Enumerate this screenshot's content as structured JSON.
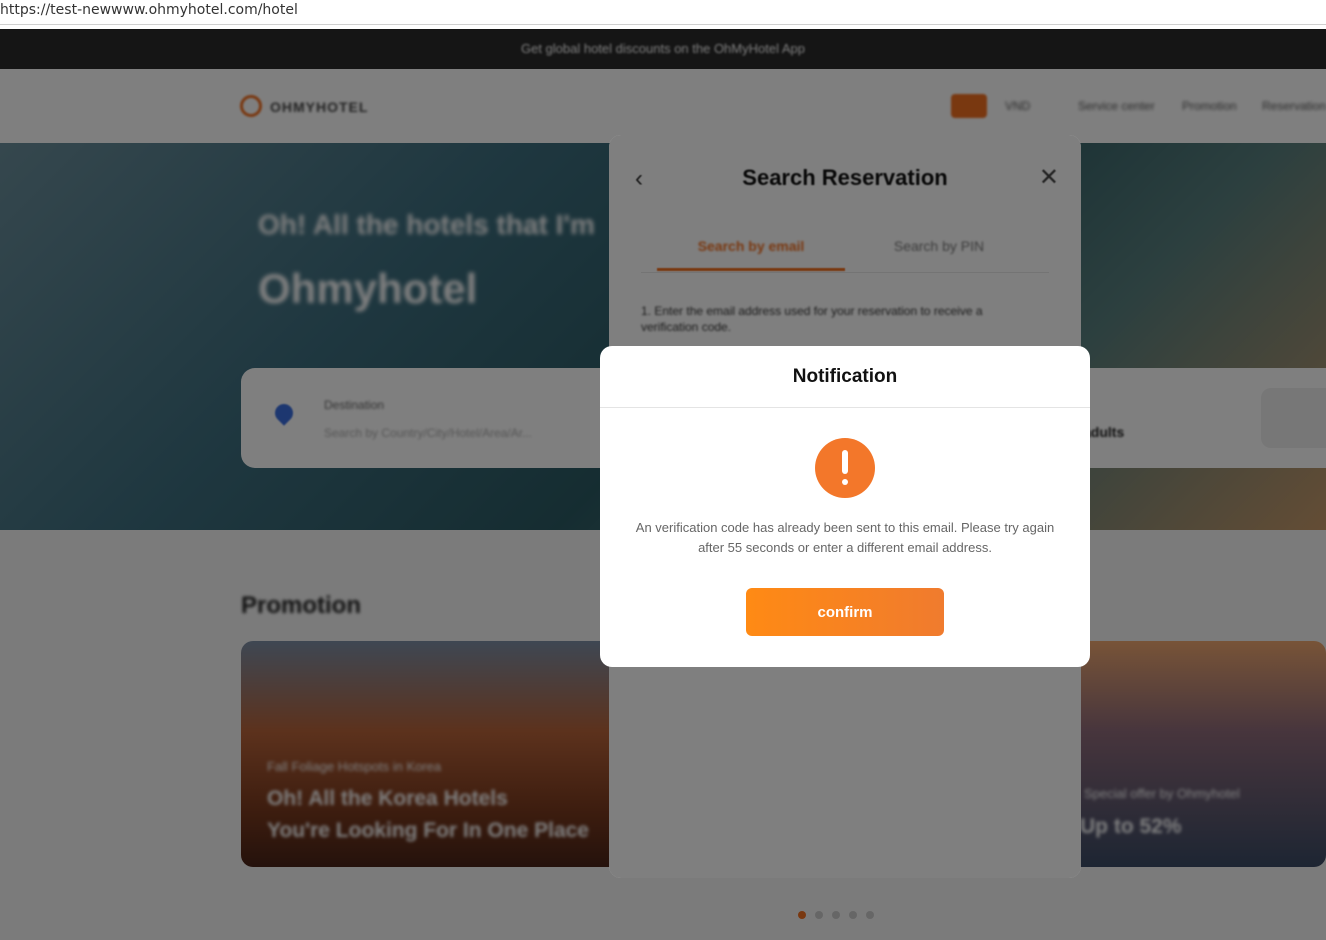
{
  "browser": {
    "url": "https://test-newwww.ohmyhotel.com/hotel"
  },
  "top_banner": {
    "text": "Get global hotel discounts on the OhMyHotel App"
  },
  "header": {
    "logo_text": "OHMYHOTEL",
    "currency": "VND",
    "nav": [
      "Service center",
      "Promotion",
      "Reservation"
    ]
  },
  "hero": {
    "subtitle": "Oh! All the hotels that I'm",
    "title": "Ohmyhotel",
    "search": {
      "destination_label": "Destination",
      "destination_placeholder": "Search by Country/City/Hotel/Area/Ar...",
      "guests": "adults"
    }
  },
  "promotion": {
    "heading": "Promotion",
    "cards": [
      {
        "small": "Fall Foliage Hotspots in Korea",
        "big_line1": "Oh! All the Korea Hotels",
        "big_line2": "You're Looking For In One Place"
      },
      {
        "small": "Special offer by Ohmyhotel",
        "big_line1": "Up to 52%"
      }
    ]
  },
  "search_reservation": {
    "title": "Search Reservation",
    "tabs": [
      "Search by email",
      "Search by PIN"
    ],
    "active_tab": "Search by email",
    "description": "1. Enter the email address used for your reservation to receive a verification code."
  },
  "notification": {
    "title": "Notification",
    "message": "An verification code has already been sent to this email. Please try again after 55 seconds or enter a different email address.",
    "confirm_label": "confirm",
    "icon": "warning-icon",
    "accent_color": "#f3772a"
  }
}
